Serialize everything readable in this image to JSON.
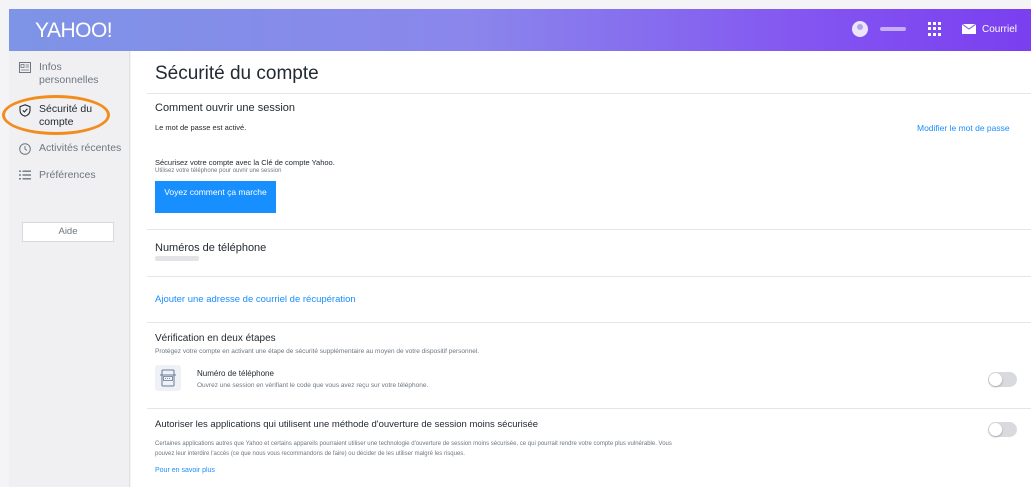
{
  "header": {
    "logo": "YAHOO!",
    "mail_label": "Courriel"
  },
  "sidebar": {
    "items": [
      {
        "label": "Infos personnelles",
        "icon": "id-card-icon"
      },
      {
        "label": "Sécurité du compte",
        "icon": "shield-icon"
      },
      {
        "label": "Activités récentes",
        "icon": "clock-icon"
      },
      {
        "label": "Préférences",
        "icon": "list-icon"
      }
    ],
    "help_label": "Aide",
    "highlight_color": "#f28c1d"
  },
  "main": {
    "title": "Sécurité du compte",
    "signin": {
      "title": "Comment ouvrir une session",
      "password_status": "Le mot de passe est activé.",
      "change_password_link": "Modifier le mot de passe",
      "key_text": "Sécurisez votre compte avec la Clé de compte Yahoo.",
      "key_subtext": "Utilisez votre téléphone pour ouvrir une session",
      "key_button": "Voyez comment ça marche"
    },
    "phones": {
      "title": "Numéros de téléphone"
    },
    "recovery_email_link": "Ajouter une adresse de courriel de récupération",
    "two_step": {
      "title": "Vérification en deux étapes",
      "description": "Protégez votre compte en activant une étape de sécurité supplémentaire au moyen de votre dispositif personnel.",
      "phone_title": "Numéro de téléphone",
      "phone_description": "Ouvrez une session en vérifiant le code que vous avez reçu sur votre téléphone."
    },
    "less_secure": {
      "title": "Autoriser les applications qui utilisent une méthode d'ouverture de session moins sécurisée",
      "description_line1": "Certaines applications autres que Yahoo et certains appareils pourraient utiliser une technologie d'ouverture de session moins sécurisée, ce qui pourrait rendre votre compte plus vulnérable. Vous",
      "description_line2": "pouvez leur interdire l'accès (ce que nous vous recommandons de faire) ou décider de les utiliser malgré les risques.",
      "learn_more_link": "Pour en savoir plus"
    }
  },
  "colors": {
    "accent": "#188fff",
    "header_start": "#7e94e6",
    "header_end": "#7a3ff0"
  }
}
